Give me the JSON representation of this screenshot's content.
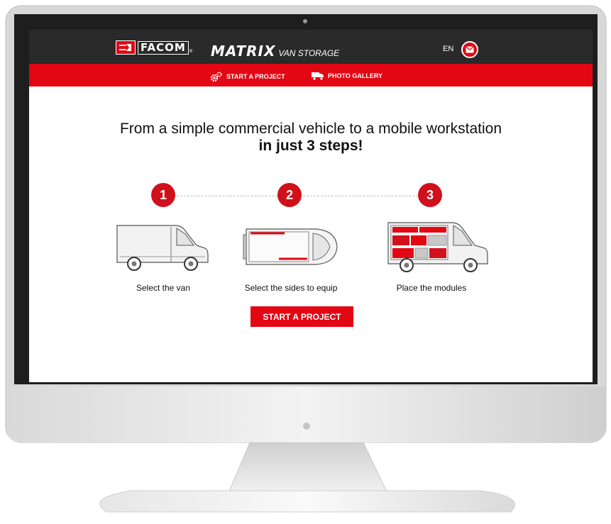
{
  "header": {
    "brand": "FACOM",
    "product": "MATRIX",
    "product_suffix": "VAN STORAGE",
    "language": "EN"
  },
  "nav": {
    "start_project": "START A PROJECT",
    "photo_gallery": "PHOTO GALLERY"
  },
  "hero": {
    "line1": "From a simple commercial vehicle to a mobile workstation",
    "line2": "in just 3 steps!"
  },
  "steps": [
    {
      "number": "1",
      "label": "Select the van"
    },
    {
      "number": "2",
      "label": "Select the sides to equip"
    },
    {
      "number": "3",
      "label": "Place the modules"
    }
  ],
  "cta": {
    "label": "START A PROJECT"
  },
  "colors": {
    "brand_red": "#e30613",
    "header_dark": "#2a2a2a"
  }
}
